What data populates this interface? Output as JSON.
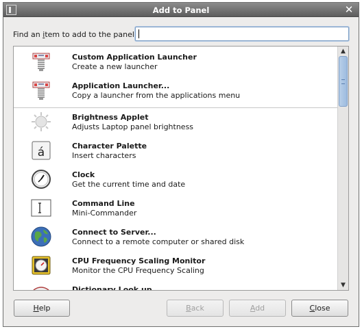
{
  "window": {
    "title": "Add to Panel",
    "close_glyph": "✕"
  },
  "search": {
    "label_prefix": "Find an ",
    "label_mnemonic": "i",
    "label_suffix": "tem to add to the panel:",
    "value": ""
  },
  "items": [
    {
      "name": "Custom Application Launcher",
      "desc": "Create a new launcher",
      "icon": "launcher-icon"
    },
    {
      "name": "Application Launcher...",
      "desc": "Copy a launcher from the applications menu",
      "icon": "launcher-icon"
    },
    {
      "name": "Brightness Applet",
      "desc": "Adjusts Laptop panel brightness",
      "icon": "brightness-icon"
    },
    {
      "name": "Character Palette",
      "desc": "Insert characters",
      "icon": "character-palette-icon"
    },
    {
      "name": "Clock",
      "desc": "Get the current time and date",
      "icon": "clock-icon"
    },
    {
      "name": "Command Line",
      "desc": "Mini-Commander",
      "icon": "command-line-icon"
    },
    {
      "name": "Connect to Server...",
      "desc": "Connect to a remote computer or shared disk",
      "icon": "globe-icon"
    },
    {
      "name": "CPU Frequency Scaling Monitor",
      "desc": "Monitor the CPU Frequency Scaling",
      "icon": "cpu-icon"
    },
    {
      "name": "Dictionary Look up",
      "desc": "",
      "icon": "dictionary-icon"
    }
  ],
  "buttons": {
    "help": {
      "mnemonic": "H",
      "rest": "elp"
    },
    "back": {
      "mnemonic": "B",
      "rest": "ack"
    },
    "add": {
      "mnemonic": "A",
      "rest": "dd"
    },
    "close": {
      "mnemonic": "C",
      "rest": "lose"
    }
  }
}
